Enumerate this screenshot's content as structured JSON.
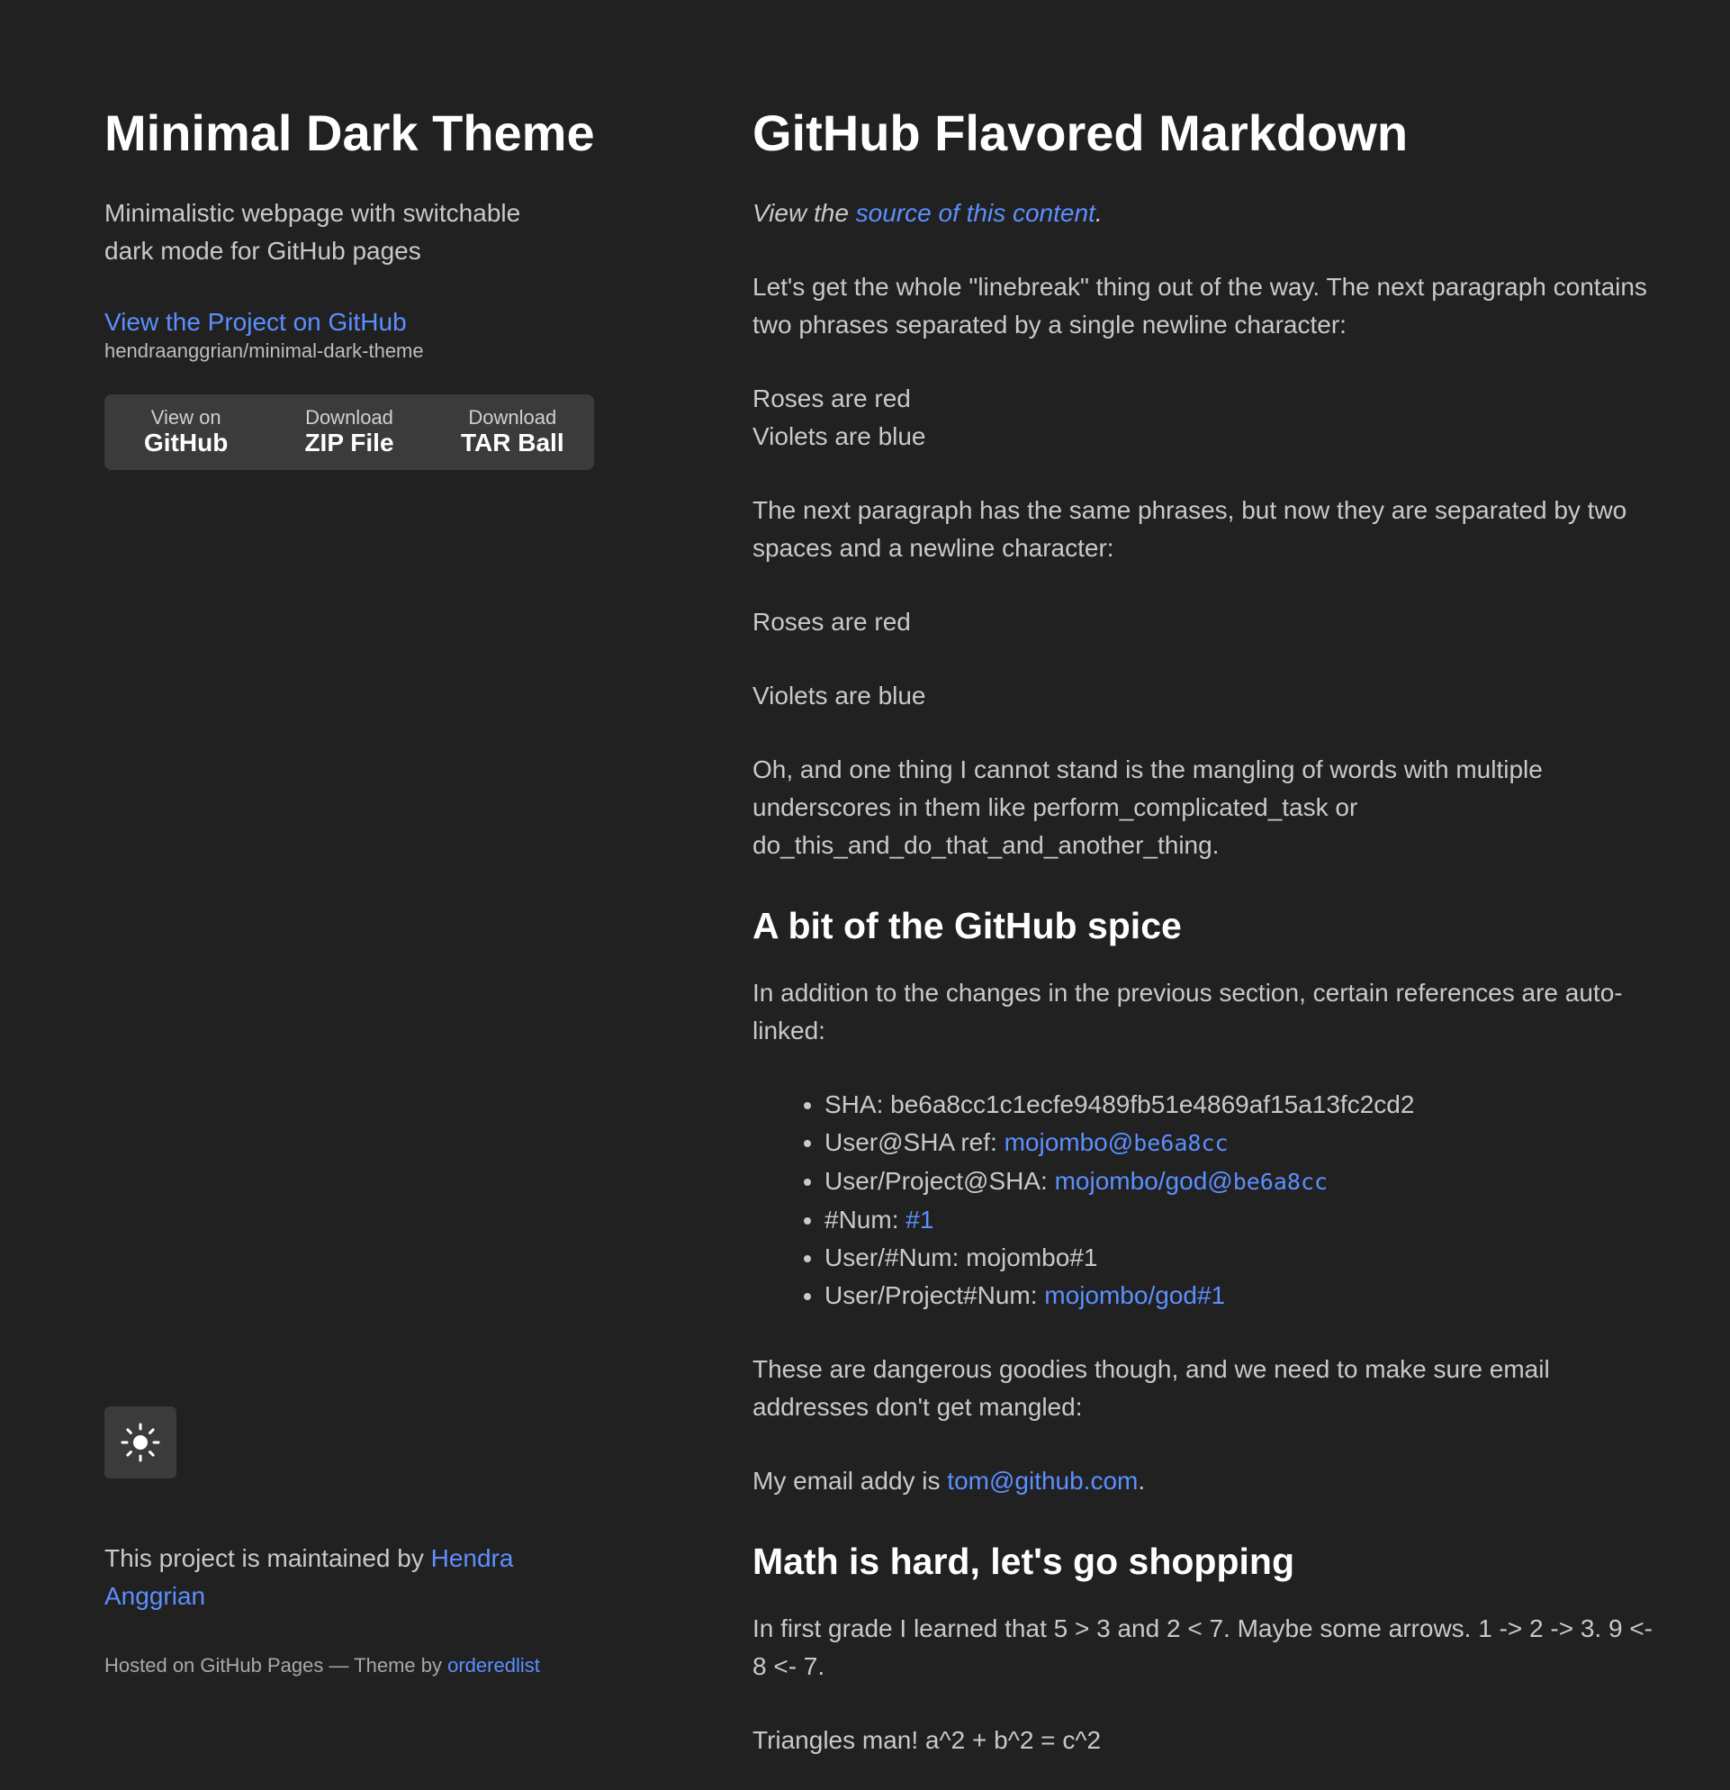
{
  "sidebar": {
    "title": "Minimal Dark Theme",
    "tagline": "Minimalistic webpage with switchable dark mode for GitHub pages",
    "project_link": "View the Project on GitHub",
    "repo_name": "hendraanggrian/minimal-dark-theme",
    "downloads": [
      {
        "small": "View on",
        "big": "GitHub"
      },
      {
        "small": "Download",
        "big": "ZIP File"
      },
      {
        "small": "Download",
        "big": "TAR Ball"
      }
    ],
    "theme_toggle_icon": "sun-icon",
    "maintained_prefix": "This project is maintained by ",
    "maintainer": "Hendra Anggrian",
    "hosted_prefix": "Hosted on GitHub Pages — Theme by ",
    "theme_author": "orderedlist"
  },
  "main": {
    "title": "GitHub Flavored Markdown",
    "intro_prefix": "View the ",
    "intro_link": "source of this content",
    "intro_suffix": ".",
    "p1": "Let's get the whole \"linebreak\" thing out of the way. The next paragraph contains two phrases separated by a single newline character:",
    "roses1": "Roses are red",
    "violets1": "Violets are blue",
    "p2": "The next paragraph has the same phrases, but now they are separated by two spaces and a newline character:",
    "roses2": "Roses are red",
    "violets2": "Violets are blue",
    "p3": "Oh, and one thing I cannot stand is the mangling of words with multiple underscores in them like perform_complicated_task or do_this_and_do_that_and_another_thing.",
    "h2_spice": "A bit of the GitHub spice",
    "p4": "In addition to the changes in the previous section, certain references are auto-linked:",
    "refs": {
      "sha_label": "SHA: be6a8cc1c1ecfe9489fb51e4869af15a13fc2cd2",
      "user_sha_label": "User@SHA ref: ",
      "user_sha_link_user": "mojombo@",
      "user_sha_link_code": "be6a8cc",
      "proj_sha_label": "User/Project@SHA: ",
      "proj_sha_link_user": "mojombo/god@",
      "proj_sha_link_code": "be6a8cc",
      "num_label": "#Num: ",
      "num_link": "#1",
      "user_num_label": "User/#Num: mojombo#1",
      "proj_num_label": "User/Project#Num: ",
      "proj_num_link": "mojombo/god#1"
    },
    "p5": "These are dangerous goodies though, and we need to make sure email addresses don't get mangled:",
    "email_prefix": "My email addy is ",
    "email_link": "tom@github.com",
    "email_suffix": ".",
    "h2_math": "Math is hard, let's go shopping",
    "p6": "In first grade I learned that 5 > 3 and 2 < 7. Maybe some arrows. 1 -> 2 -> 3. 9 <- 8 <- 7.",
    "p7": "Triangles man! a^2 + b^2 = c^2"
  },
  "colors": {
    "background": "#212121",
    "link": "#5c8fff",
    "heading": "#ffffff",
    "text": "#c9c9c9",
    "button_bg": "#3b3b3b"
  }
}
